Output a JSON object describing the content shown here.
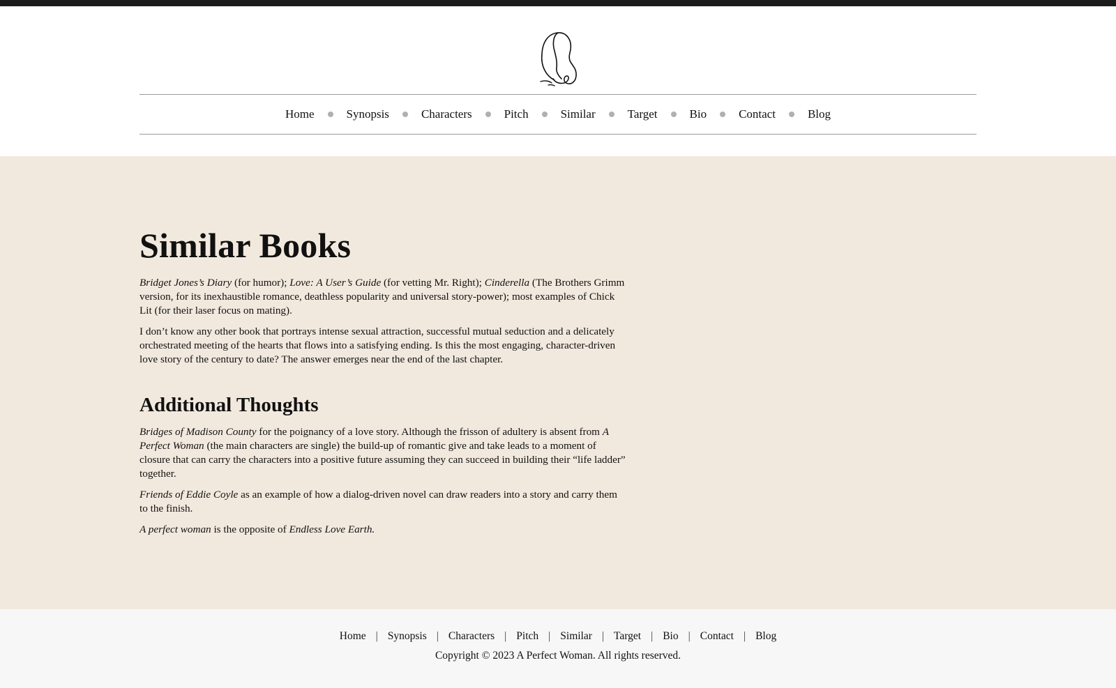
{
  "nav": [
    "Home",
    "Synopsis",
    "Characters",
    "Pitch",
    "Similar",
    "Target",
    "Bio",
    "Contact",
    "Blog"
  ],
  "colors": {
    "topbar": "#1b1b1b",
    "main_bg": "#f2e9de",
    "footer_bg": "#f7f7f7",
    "nav_dot": "#b0b0b0"
  },
  "logo": {
    "icon": "woman-profile-line-art-icon"
  },
  "main": {
    "title": "Similar Books",
    "p1": [
      {
        "t": "Bridget Jones’s Diary",
        "i": true
      },
      {
        "t": " (for humor); "
      },
      {
        "t": "Love: A User’s Guide",
        "i": true
      },
      {
        "t": " (for vetting Mr. Right); "
      },
      {
        "t": "Cinderella",
        "i": true
      },
      {
        "t": " (The Brothers Grimm version, for its inexhaustible romance, deathless popularity and universal story-power); most examples of Chick Lit (for their laser focus on mating)."
      }
    ],
    "p2": "I don’t know any other book that portrays intense sexual attraction, successful mutual seduction and a delicately orchestrated meeting of the hearts that flows into a satisfying ending. Is this the most engaging, character-driven love story of the century to date? The answer emerges near the end of the last chapter.",
    "subtitle": "Additional Thoughts",
    "p3": [
      {
        "t": "Bridges of Madison County",
        "i": true
      },
      {
        "t": " for the poignancy of a love story. Although the frisson of adultery is absent from "
      },
      {
        "t": "A Perfect Woman",
        "i": true
      },
      {
        "t": " (the main characters are single) the build-up of romantic give and take leads to a moment of closure that can carry the characters into a positive future assuming they can succeed in building their “life ladder” together."
      }
    ],
    "p4": [
      {
        "t": "Friends of Eddie Coyle",
        "i": true
      },
      {
        "t": " as an example of how a dialog-driven novel can draw readers into a story and carry them to the finish."
      }
    ],
    "p5": [
      {
        "t": "A perfect woman",
        "i": true
      },
      {
        "t": " is the opposite of "
      },
      {
        "t": "Endless Love Earth.",
        "i": true
      }
    ]
  },
  "footer": {
    "nav": [
      "Home",
      "Synopsis",
      "Characters",
      "Pitch",
      "Similar",
      "Target",
      "Bio",
      "Contact",
      "Blog"
    ],
    "separator": "|",
    "copyright": "Copyright © 2023 A Perfect Woman. All rights reserved."
  }
}
